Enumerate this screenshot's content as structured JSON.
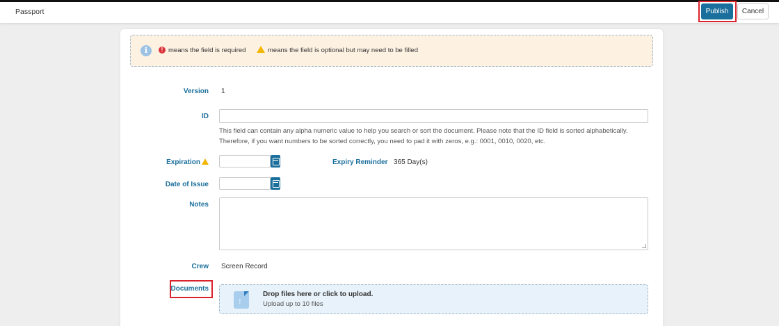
{
  "header": {
    "title": "Passport",
    "publish_label": "Publish",
    "cancel_label": "Cancel"
  },
  "notice": {
    "info_icon": "i",
    "required_icon": "!",
    "required_text": "means the field is required",
    "optional_text": "means the field is optional but may need to be filled"
  },
  "form": {
    "version_label": "Version",
    "version_value": "1",
    "id_label": "ID",
    "id_value": "",
    "id_help": "This field can contain any alpha numeric value to help you search or sort the document. Please note that the ID field is sorted alphabetically. Therefore, if you want numbers to be sorted correctly, you need to pad it with zeros, e.g.: 0001, 0010, 0020, etc.",
    "expiration_label": "Expiration",
    "expiration_value": "",
    "expiry_reminder_label": "Expiry Reminder",
    "expiry_reminder_value": "365 Day(s)",
    "date_of_issue_label": "Date of Issue",
    "date_of_issue_value": "",
    "notes_label": "Notes",
    "notes_value": "",
    "crew_label": "Crew",
    "crew_value": "Screen Record",
    "documents_label": "Documents",
    "dropzone_title": "Drop files here or click to upload.",
    "dropzone_subtitle": "Upload up to 10 files"
  },
  "colors": {
    "accent": "#1b6f9c",
    "highlight": "#d9232d",
    "notice_bg": "#fdf1e2",
    "dropzone_bg": "#e8f2fa",
    "required": "#d9343a",
    "warning": "#f2b705"
  }
}
